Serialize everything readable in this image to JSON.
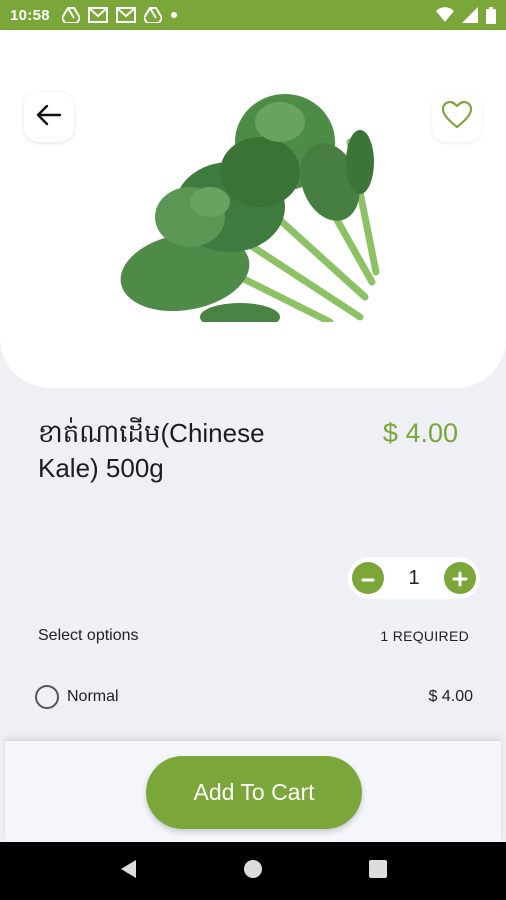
{
  "status_bar": {
    "time": "10:58",
    "left_icons": [
      "drive-icon",
      "mail-icon",
      "mail-icon",
      "drive-icon",
      "dot-icon"
    ],
    "right_icons": [
      "wifi-icon",
      "signal-icon",
      "battery-icon"
    ]
  },
  "product": {
    "name": "ខាត់ណាដើម(Chinese Kale) 500g",
    "price": "$ 4.00",
    "quantity": "1"
  },
  "options": {
    "label": "Select options",
    "required": "1 REQUIRED",
    "items": [
      {
        "name": "Normal",
        "price": "$ 4.00",
        "selected": false
      }
    ]
  },
  "cart": {
    "button_label": "Add To Cart"
  },
  "colors": {
    "accent": "#7aa63a",
    "background": "#eef0f6"
  }
}
